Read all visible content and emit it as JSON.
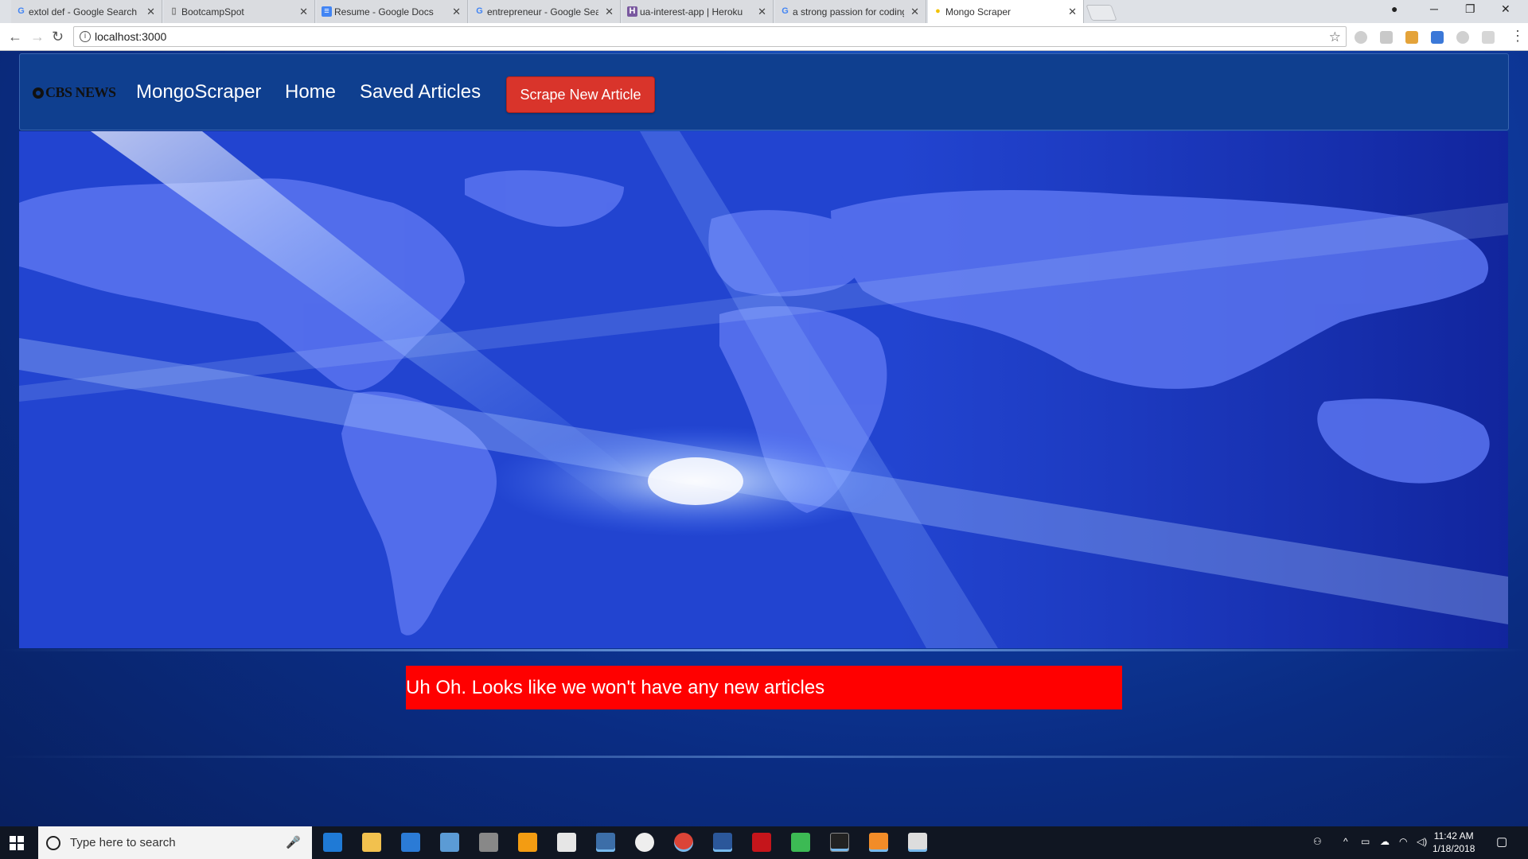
{
  "browser": {
    "tabs": [
      {
        "label": "extol def - Google Search",
        "favicon": "G"
      },
      {
        "label": "BootcampSpot",
        "favicon": "doc"
      },
      {
        "label": "Resume - Google Docs",
        "favicon": "docs"
      },
      {
        "label": "entrepreneur - Google Search",
        "favicon": "G"
      },
      {
        "label": "ua-interest-app | Heroku",
        "favicon": "H"
      },
      {
        "label": "a strong passion for coding",
        "favicon": "G"
      },
      {
        "label": "Mongo Scraper",
        "favicon": "bulb"
      }
    ],
    "url": "localhost:3000"
  },
  "navbar": {
    "brand_logo_text": "CBS NEWS",
    "app_name": "MongoScraper",
    "links": [
      "Home",
      "Saved Articles"
    ],
    "scrape_button": "Scrape New Article"
  },
  "alert": {
    "message": "Uh Oh. Looks like we won't have any new articles"
  },
  "taskbar": {
    "search_placeholder": "Type here to search",
    "time": "11:42 AM",
    "date": "1/18/2018"
  },
  "colors": {
    "navbar_bg": "#0f3f8f",
    "scrape_button_bg": "#d9342b",
    "alert_bg": "#ff0000",
    "hero_blue": "#2346d4"
  }
}
